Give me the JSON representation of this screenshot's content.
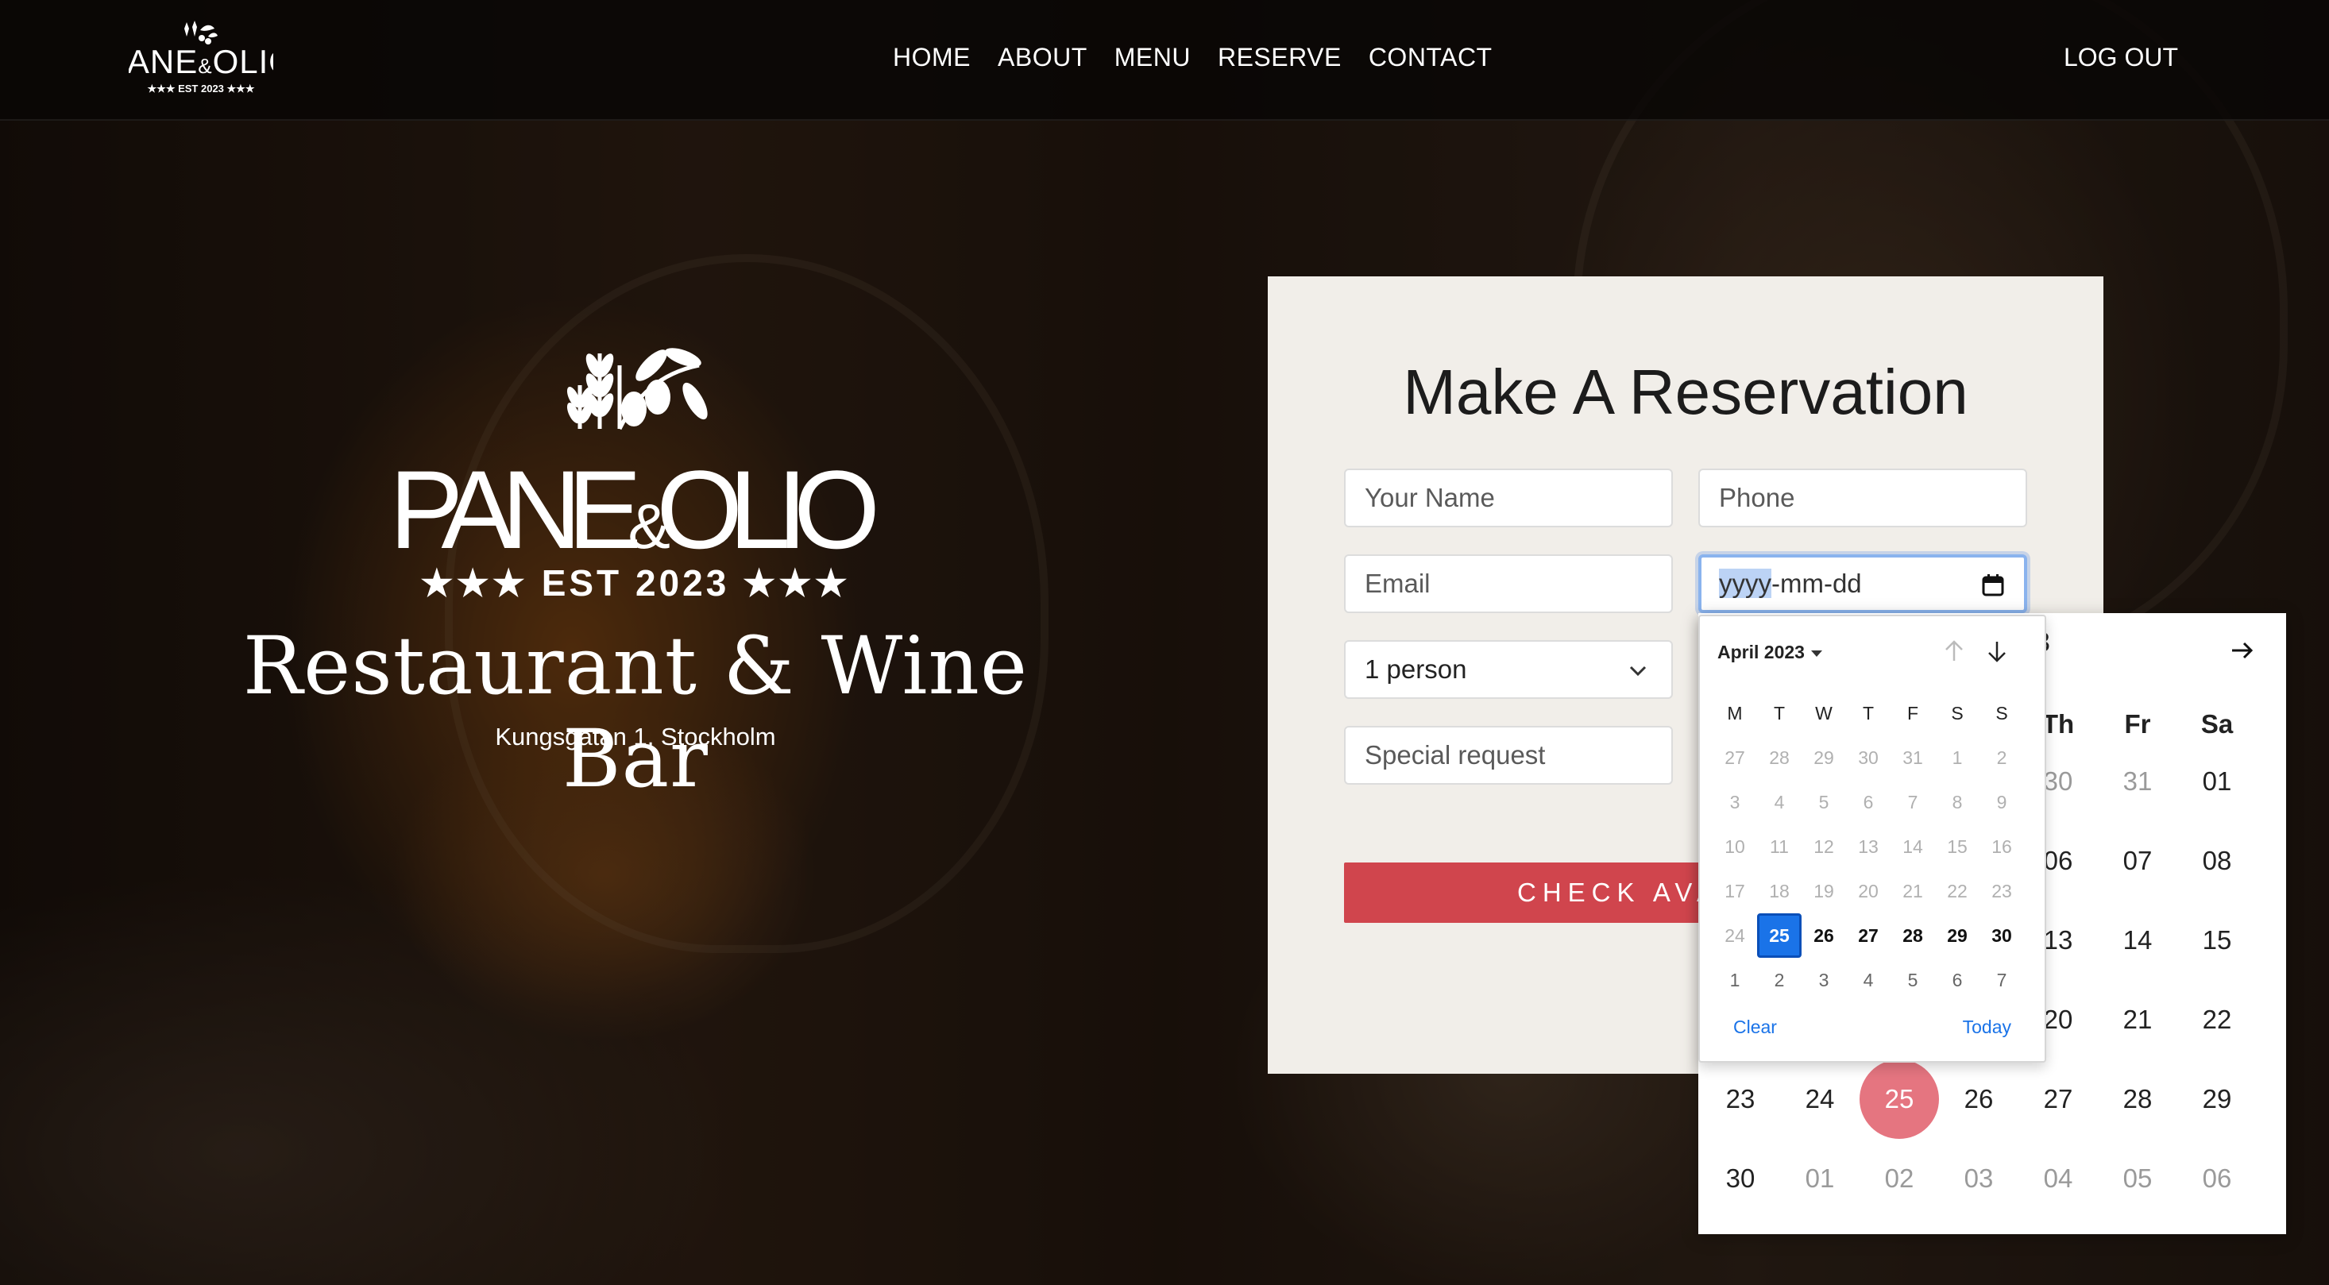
{
  "brand": {
    "logo_name": "PANE&OLIO",
    "logo_est": "EST 2023"
  },
  "nav": {
    "links": [
      "HOME",
      "ABOUT",
      "MENU",
      "RESERVE",
      "CONTACT"
    ],
    "logout": "LOG OUT"
  },
  "hero": {
    "title": "Restaurant & Wine Bar",
    "address": "Kungsgatan 1, Stockholm"
  },
  "reservation": {
    "title": "Make A Reservation",
    "name_placeholder": "Your Name",
    "phone_placeholder": "Phone",
    "email_placeholder": "Email",
    "date_placeholder_selected": "yyyy",
    "date_placeholder_rest": "-mm-dd",
    "guests_value": "1 person",
    "special_placeholder": "Special request",
    "check_button": "CHECK AVA"
  },
  "big_calendar": {
    "partial_header": "3",
    "weekday_headers": [
      "Th",
      "Fr",
      "Sa"
    ],
    "rows": [
      [
        {
          "d": "30",
          "m": true
        },
        {
          "d": "31",
          "m": true
        },
        {
          "d": "01",
          "m": false
        }
      ],
      [
        {
          "d": "06",
          "m": false
        },
        {
          "d": "07",
          "m": false
        },
        {
          "d": "08",
          "m": false
        }
      ],
      [
        {
          "d": "13",
          "m": false
        },
        {
          "d": "14",
          "m": false
        },
        {
          "d": "15",
          "m": false
        }
      ],
      [
        {
          "d": "20",
          "m": false
        },
        {
          "d": "21",
          "m": false
        },
        {
          "d": "22",
          "m": false
        }
      ]
    ],
    "full_rows": [
      [
        {
          "d": "23",
          "m": false
        },
        {
          "d": "24",
          "m": false
        },
        {
          "d": "25",
          "m": false,
          "sel": true
        },
        {
          "d": "26",
          "m": false
        },
        {
          "d": "27",
          "m": false
        },
        {
          "d": "28",
          "m": false
        },
        {
          "d": "29",
          "m": false
        }
      ],
      [
        {
          "d": "30",
          "m": false
        },
        {
          "d": "01",
          "m": true
        },
        {
          "d": "02",
          "m": true
        },
        {
          "d": "03",
          "m": true
        },
        {
          "d": "04",
          "m": true
        },
        {
          "d": "05",
          "m": true
        },
        {
          "d": "06",
          "m": true
        }
      ]
    ]
  },
  "mini_calendar": {
    "month_label": "April 2023",
    "weekdays": [
      "M",
      "T",
      "W",
      "T",
      "F",
      "S",
      "S"
    ],
    "weeks": [
      [
        {
          "d": "27",
          "t": "p"
        },
        {
          "d": "28",
          "t": "p"
        },
        {
          "d": "29",
          "t": "p"
        },
        {
          "d": "30",
          "t": "p"
        },
        {
          "d": "31",
          "t": "p"
        },
        {
          "d": "1",
          "t": "p"
        },
        {
          "d": "2",
          "t": "p"
        }
      ],
      [
        {
          "d": "3",
          "t": "p"
        },
        {
          "d": "4",
          "t": "p"
        },
        {
          "d": "5",
          "t": "p"
        },
        {
          "d": "6",
          "t": "p"
        },
        {
          "d": "7",
          "t": "p"
        },
        {
          "d": "8",
          "t": "p"
        },
        {
          "d": "9",
          "t": "p"
        }
      ],
      [
        {
          "d": "10",
          "t": "p"
        },
        {
          "d": "11",
          "t": "p"
        },
        {
          "d": "12",
          "t": "p"
        },
        {
          "d": "13",
          "t": "p"
        },
        {
          "d": "14",
          "t": "p"
        },
        {
          "d": "15",
          "t": "p"
        },
        {
          "d": "16",
          "t": "p"
        }
      ],
      [
        {
          "d": "17",
          "t": "p"
        },
        {
          "d": "18",
          "t": "p"
        },
        {
          "d": "19",
          "t": "p"
        },
        {
          "d": "20",
          "t": "p"
        },
        {
          "d": "21",
          "t": "p"
        },
        {
          "d": "22",
          "t": "p"
        },
        {
          "d": "23",
          "t": "p"
        }
      ],
      [
        {
          "d": "24",
          "t": "p"
        },
        {
          "d": "25",
          "t": "s"
        },
        {
          "d": "26",
          "t": "c"
        },
        {
          "d": "27",
          "t": "c"
        },
        {
          "d": "28",
          "t": "c"
        },
        {
          "d": "29",
          "t": "c"
        },
        {
          "d": "30",
          "t": "c"
        }
      ],
      [
        {
          "d": "1",
          "t": "n"
        },
        {
          "d": "2",
          "t": "n"
        },
        {
          "d": "3",
          "t": "n"
        },
        {
          "d": "4",
          "t": "n"
        },
        {
          "d": "5",
          "t": "n"
        },
        {
          "d": "6",
          "t": "n"
        },
        {
          "d": "7",
          "t": "n"
        }
      ]
    ],
    "clear_label": "Clear",
    "today_label": "Today"
  },
  "colors": {
    "accent_red": "#d0454d",
    "selected_pink": "#e57580",
    "picker_blue": "#1a73e8"
  }
}
